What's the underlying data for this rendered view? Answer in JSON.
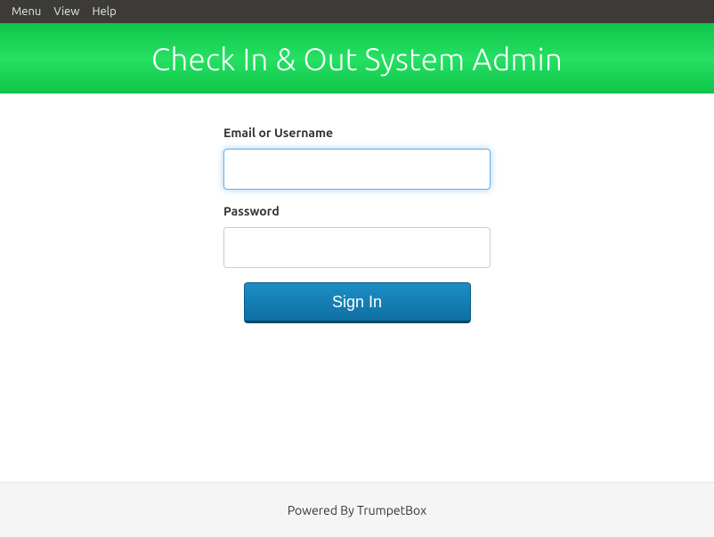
{
  "menubar": {
    "items": [
      "Menu",
      "View",
      "Help"
    ]
  },
  "banner": {
    "title": "Check In & Out System Admin"
  },
  "form": {
    "email_label": "Email or Username",
    "email_value": "",
    "password_label": "Password",
    "password_value": "",
    "signin_label": "Sign In"
  },
  "footer": {
    "text": "Powered By TrumpetBox"
  }
}
